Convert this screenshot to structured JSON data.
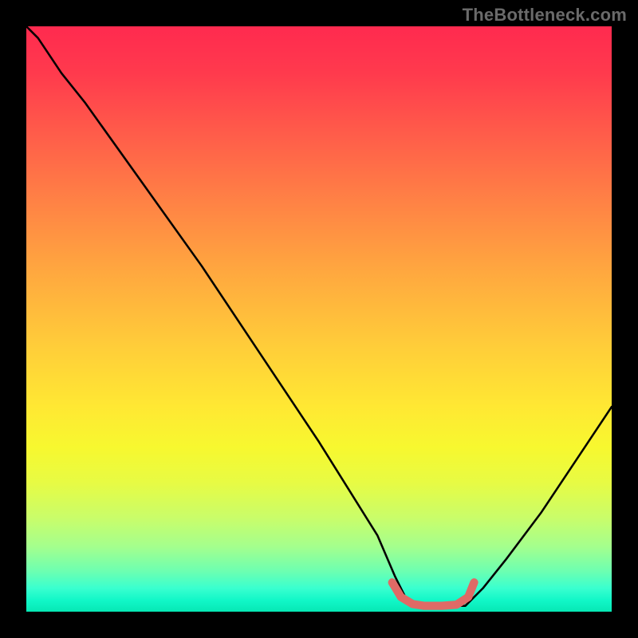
{
  "watermark": "TheBottleneck.com",
  "chart_data": {
    "type": "line",
    "title": "",
    "xlabel": "",
    "ylabel": "",
    "xlim": [
      0,
      100
    ],
    "ylim": [
      0,
      100
    ],
    "grid": false,
    "series": [
      {
        "name": "black-curve",
        "color": "#000000",
        "x": [
          0,
          2,
          4,
          6,
          10,
          20,
          30,
          40,
          50,
          55,
          60,
          63,
          64,
          65,
          68,
          72,
          75,
          76,
          78,
          82,
          88,
          94,
          100
        ],
        "values": [
          100,
          98,
          95,
          92,
          87,
          73,
          59,
          44,
          29,
          21,
          13,
          6,
          4,
          2,
          1,
          1,
          1,
          2,
          4,
          9,
          17,
          26,
          35
        ]
      },
      {
        "name": "red-highlight",
        "color": "#df6a66",
        "x": [
          62.5,
          64,
          66,
          68,
          71,
          73.5,
          75.5,
          76.5
        ],
        "values": [
          5,
          2.5,
          1.3,
          1,
          1,
          1.2,
          2.5,
          5
        ]
      }
    ],
    "annotations": []
  }
}
